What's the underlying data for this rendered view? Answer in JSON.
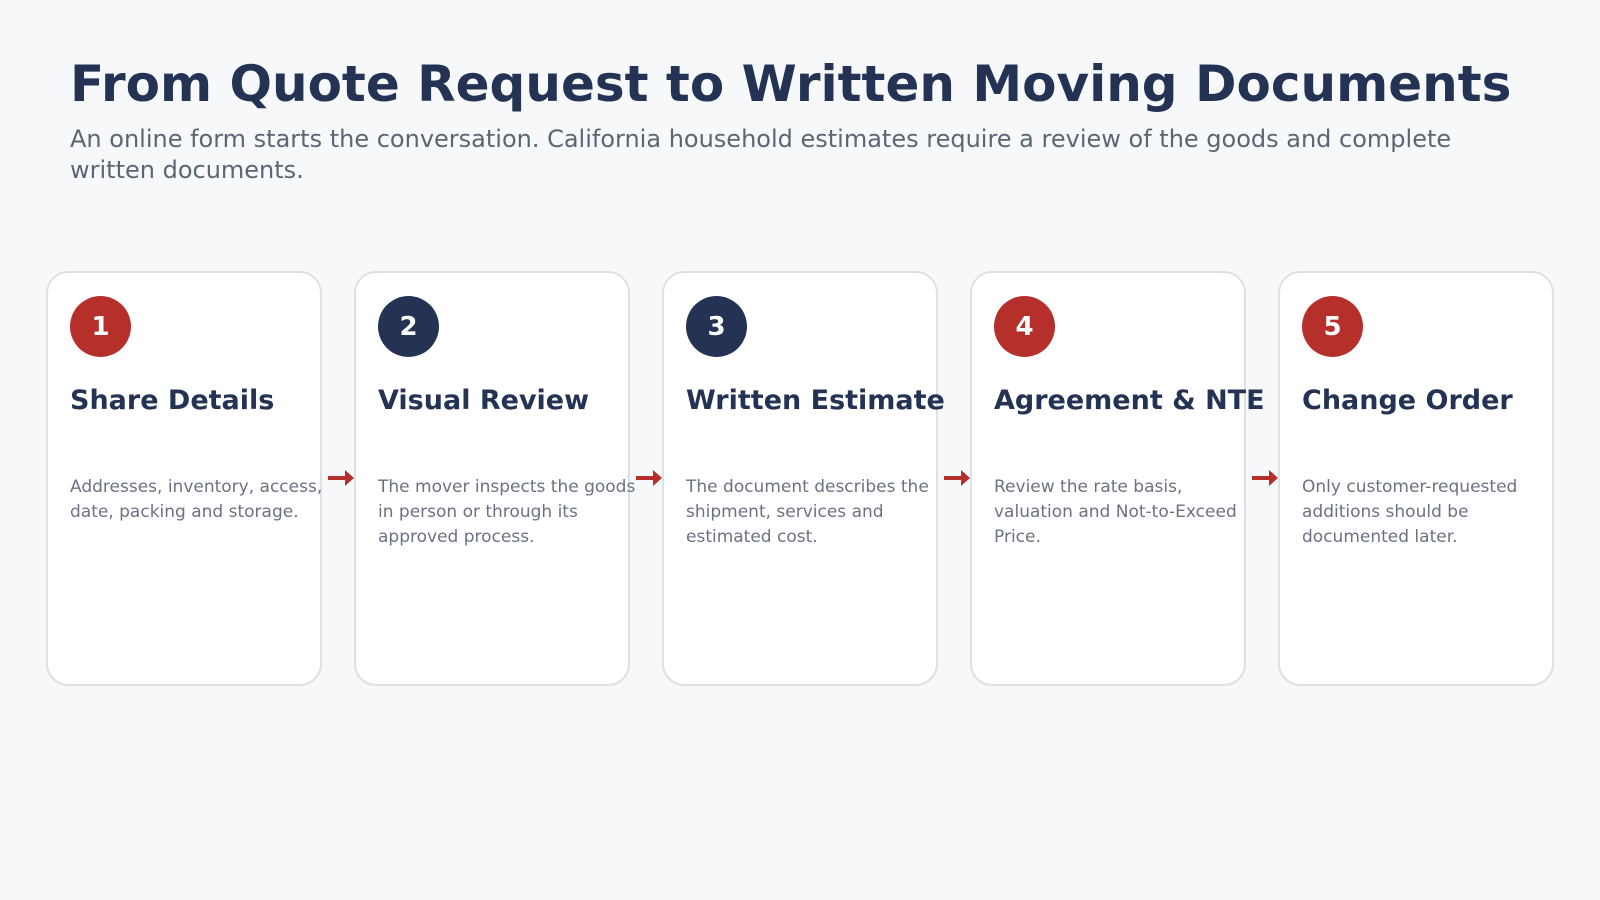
{
  "header": {
    "title": "From Quote Request to Written Moving Documents",
    "subtitle": "An online form starts the conversation. California household estimates require a review of the goods and complete written documents."
  },
  "colors": {
    "accent_red": "#b5302a",
    "accent_navy": "#243353",
    "text_muted": "#6b7280"
  },
  "steps": [
    {
      "number": "1",
      "title": "Share Details",
      "description": "Addresses, inventory, access, date, packing and storage.",
      "badge_color": "#b5302a"
    },
    {
      "number": "2",
      "title": "Visual Review",
      "description": "The mover inspects the goods in person or through its approved process.",
      "badge_color": "#243353"
    },
    {
      "number": "3",
      "title": "Written Estimate",
      "description": "The document describes the shipment, services and estimated cost.",
      "badge_color": "#243353"
    },
    {
      "number": "4",
      "title": "Agreement & NTE",
      "description": "Review the rate basis, valuation and Not-to-Exceed Price.",
      "badge_color": "#b5302a"
    },
    {
      "number": "5",
      "title": "Change Order",
      "description": "Only customer-requested additions should be documented later.",
      "badge_color": "#b5302a"
    }
  ],
  "connectors": {
    "icon": "arrow-right-icon",
    "color": "#b5302a"
  }
}
